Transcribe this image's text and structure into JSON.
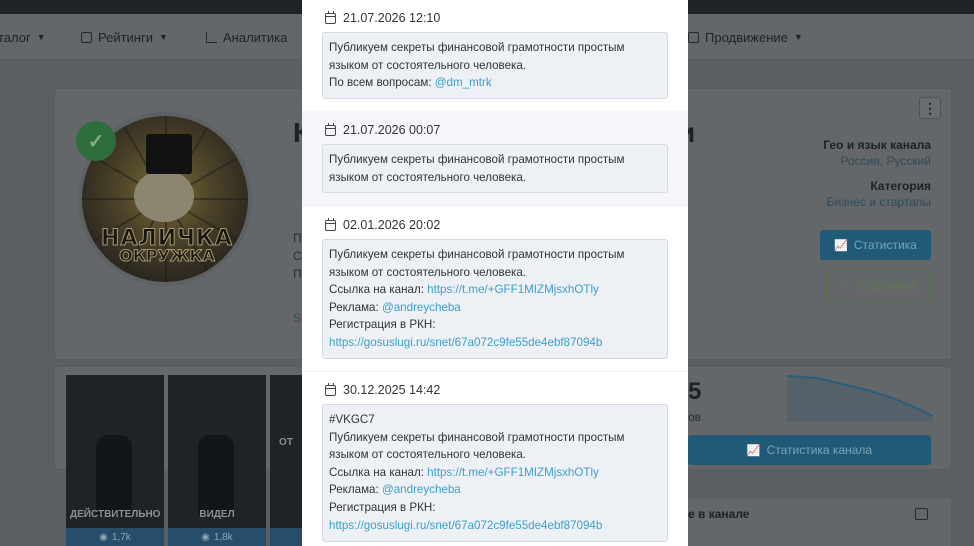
{
  "nav": {
    "items": [
      {
        "label": "талог",
        "has_icon": false
      },
      {
        "label": "Рейтинги",
        "has_icon": true
      },
      {
        "label": "Аналитика",
        "has_icon": true
      },
      {
        "label": "Продвижение",
        "has_icon": true
      }
    ]
  },
  "channel": {
    "title_left": "К",
    "title_right": "и",
    "avatar_text_1": "НАЛИЧКА",
    "avatar_text_2": "ОКРУЖКА",
    "side_letters": [
      "П",
      "С",
      "П"
    ],
    "side_letter_s": "S",
    "geo_label": "Гео и язык канала",
    "geo_value": "Россия, Русский",
    "category_label": "Категория",
    "category_value": "Бизнес и стартапы",
    "stats_button": "Статистика",
    "favorite_button": "Избранное",
    "big_number": "5",
    "big_number_sub": "ов",
    "channel_stats_button": "Статистика канала",
    "likes_title": "е в канале"
  },
  "thumbnails": [
    {
      "caption": "ДЕЙСТВИТЕЛЬНО",
      "views": "1,7k"
    },
    {
      "caption": "ВИДЕЛ",
      "views": "1,8k"
    },
    {
      "caption": "ОТ",
      "views": ""
    }
  ],
  "modal": {
    "posts": [
      {
        "date": "21.07.2026 12:10",
        "lines": [
          {
            "text": "Публикуем секреты финансовой грамотности простым"
          },
          {
            "text": "языком от состоятельного человека."
          },
          {
            "text": "По всем вопросам: ",
            "link": "@dm_mtrk"
          }
        ]
      },
      {
        "date": "21.07.2026 00:07",
        "lines": [
          {
            "text": "Публикуем секреты финансовой грамотности простым"
          },
          {
            "text": "языком от состоятельного человека."
          }
        ]
      },
      {
        "date": "02.01.2026 20:02",
        "lines": [
          {
            "text": "Публикуем секреты финансовой грамотности простым"
          },
          {
            "text": "языком от состоятельного человека."
          },
          {
            "text": "Ссылка на канал: ",
            "link": "https://t.me/+GFF1MIZMjsxhOTly"
          },
          {
            "text": "Реклама: ",
            "link": "@andreycheba"
          },
          {
            "text": "Регистрация в РКН:"
          },
          {
            "text": "",
            "link": "https://gosuslugi.ru/snet/67a072c9fe55de4ebf87094b"
          }
        ]
      },
      {
        "date": "30.12.2025 14:42",
        "lines": [
          {
            "text": "#VKGC7"
          },
          {
            "text": "Публикуем секреты финансовой грамотности простым"
          },
          {
            "text": "языком от состоятельного человека."
          },
          {
            "text": "Ссылка на канал: ",
            "link": "https://t.me/+GFF1MIZMjsxhOTly"
          },
          {
            "text": "Реклама: ",
            "link": "@andreycheba"
          },
          {
            "text": "Регистрация в РКН:"
          },
          {
            "text": "",
            "link": "https://gosuslugi.ru/snet/67a072c9fe55de4ebf87094b"
          }
        ]
      }
    ]
  }
}
